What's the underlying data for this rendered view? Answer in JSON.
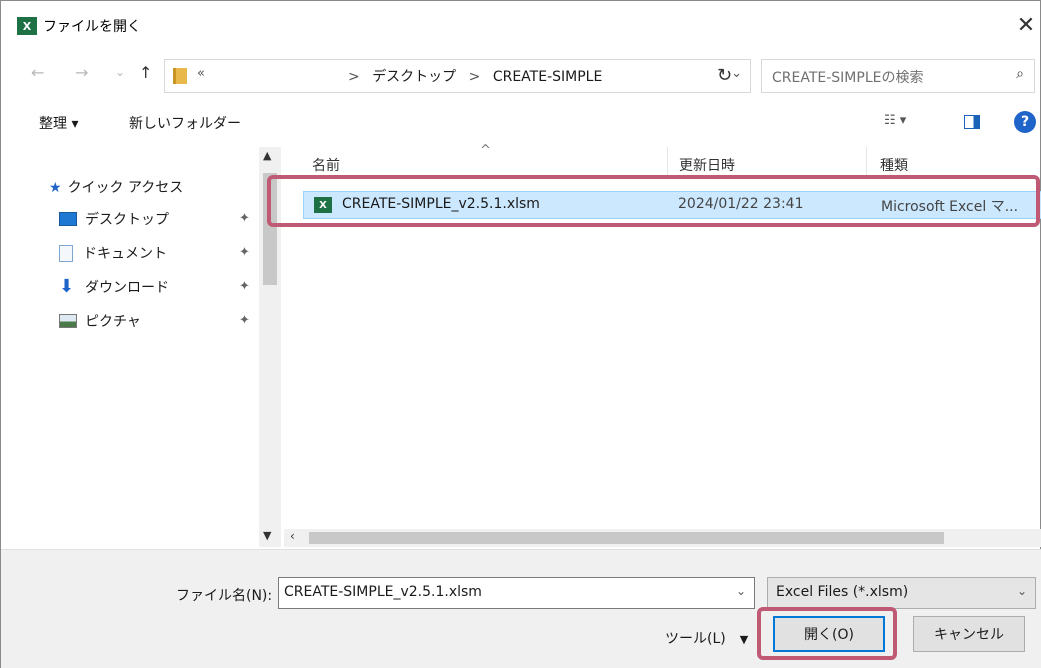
{
  "window": {
    "title": "ファイルを開く",
    "app_icon_text": "X",
    "close_glyph": "✕"
  },
  "nav": {
    "back": "←",
    "forward": "→",
    "recent": "⌄",
    "up": "↑",
    "overflow": "«",
    "path": [
      "デスクトップ",
      "CREATE-SIMPLE"
    ],
    "path_separator": ">",
    "address_dropdown": "⌄",
    "refresh": "↻",
    "search_placeholder": "CREATE-SIMPLEの検索",
    "search_icon": "⌕"
  },
  "toolbar": {
    "organize": "整理 ▾",
    "new_folder": "新しいフォルダー",
    "view_icon": "☷ ▾",
    "help": "?"
  },
  "sidebar": {
    "quick_access": "クイック アクセス",
    "items": [
      {
        "label": "デスクトップ",
        "icon": "desktop-icon",
        "color": "#1f78d1"
      },
      {
        "label": "ドキュメント",
        "icon": "document-icon",
        "color": "#7fa7cf"
      },
      {
        "label": "ダウンロード",
        "icon": "download-icon",
        "color": "#1f64c8"
      },
      {
        "label": "ピクチャ",
        "icon": "pictures-icon",
        "color": "#4a7a4a"
      }
    ],
    "pin_glyph": "📌"
  },
  "files": {
    "columns": {
      "name": "名前",
      "modified": "更新日時",
      "type": "種類"
    },
    "sort_indicator": "^",
    "rows": [
      {
        "name": "CREATE-SIMPLE_v2.5.1.xlsm",
        "modified": "2024/01/22 23:41",
        "type": "Microsoft Excel マ...",
        "selected": true
      }
    ]
  },
  "footer": {
    "filename_label": "ファイル名(N):",
    "filename_value": "CREATE-SIMPLE_v2.5.1.xlsm",
    "filetype_value": "Excel Files (*.xlsm)",
    "tools_label": "ツール(L)",
    "open_button": "開く(O)",
    "cancel_button": "キャンセル"
  },
  "colors": {
    "highlight": "#c05a74",
    "selection": "#cce8ff",
    "accent": "#0078d7",
    "excel_green": "#1e7145"
  }
}
